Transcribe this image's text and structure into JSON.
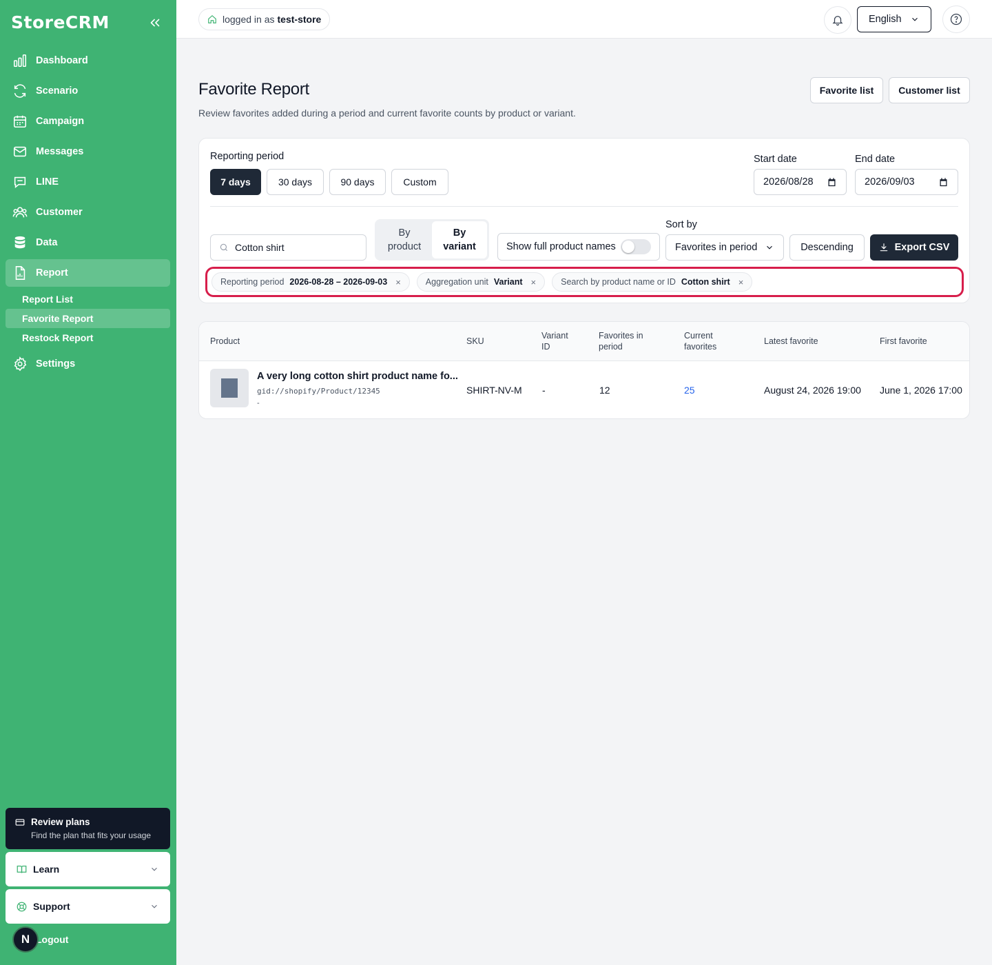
{
  "sidebar": {
    "brand": "StoreCRM",
    "items": [
      {
        "label": "Dashboard",
        "icon": "bar-chart-icon"
      },
      {
        "label": "Scenario",
        "icon": "refresh-icon"
      },
      {
        "label": "Campaign",
        "icon": "calendar-icon"
      },
      {
        "label": "Messages",
        "icon": "mail-icon"
      },
      {
        "label": "LINE",
        "icon": "chat-icon"
      },
      {
        "label": "Customer",
        "icon": "users-icon"
      },
      {
        "label": "Data",
        "icon": "database-icon"
      },
      {
        "label": "Report",
        "icon": "file-chart-icon"
      },
      {
        "label": "Settings",
        "icon": "gear-icon"
      }
    ],
    "report_sub": [
      "Report List",
      "Favorite Report",
      "Restock Report"
    ],
    "plans_title": "Review plans",
    "plans_sub": "Find the plan that fits your usage",
    "learn": "Learn",
    "support": "Support",
    "avatar_letter": "N",
    "logout": "Logout"
  },
  "topbar": {
    "logged_prefix": "logged in as",
    "store": "test-store",
    "language": "English"
  },
  "header": {
    "title": "Favorite Report",
    "description": "Review favorites added during a period and current favorite counts by product or variant.",
    "favorite_list": "Favorite list",
    "customer_list": "Customer list"
  },
  "filters": {
    "period_label": "Reporting period",
    "periods": [
      "7 days",
      "30 days",
      "90 days",
      "Custom"
    ],
    "start_label": "Start date",
    "start_value": "2026/08/28",
    "end_label": "End date",
    "end_value": "2026/09/03",
    "search_value": "Cotton shirt",
    "by_product_1": "By",
    "by_product_2": "product",
    "by_variant_1": "By",
    "by_variant_2": "variant",
    "show_full_names": "Show full product names",
    "sort_label": "Sort by",
    "sort_value": "Favorites in period",
    "order": "Descending",
    "export": "Export CSV",
    "chips": [
      {
        "key": "Reporting period",
        "value": "2026-08-28 – 2026-09-03"
      },
      {
        "key": "Aggregation unit",
        "value": "Variant"
      },
      {
        "key": "Search by product name or ID",
        "value": "Cotton shirt"
      }
    ]
  },
  "table": {
    "headers": {
      "product": "Product",
      "sku": "SKU",
      "variant_1": "Variant",
      "variant_2": "ID",
      "fav_period_1": "Favorites in",
      "fav_period_2": "period",
      "current_1": "Current",
      "current_2": "favorites",
      "latest": "Latest favorite",
      "first": "First favorite"
    },
    "rows": [
      {
        "name": "A very long cotton shirt product name fo...",
        "gid": "gid://shopify/Product/12345",
        "sub": "-",
        "sku": "SHIRT-NV-M",
        "variant_id": "-",
        "fav_period": "12",
        "current": "25",
        "latest": "August 24, 2026 19:00",
        "first": "June 1, 2026 17:00"
      }
    ]
  }
}
